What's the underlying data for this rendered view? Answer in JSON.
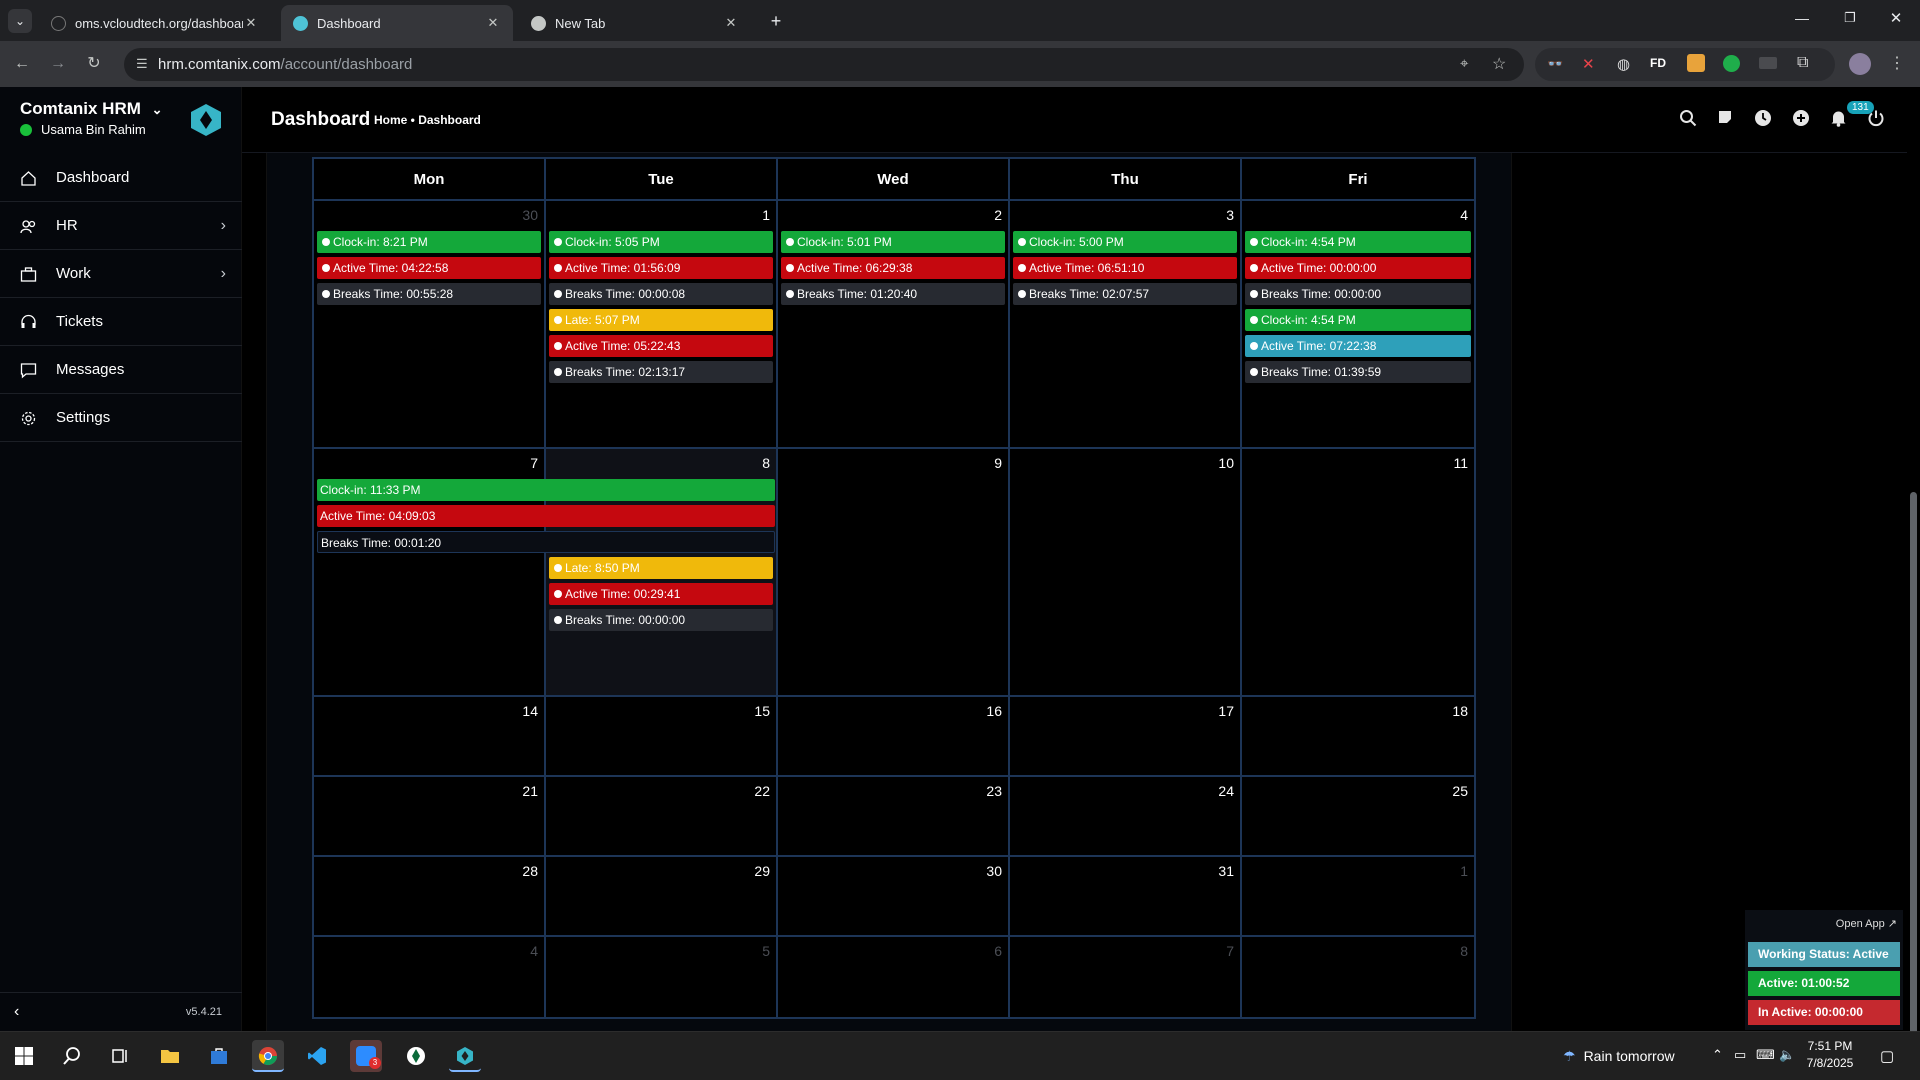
{
  "browser": {
    "tabs": [
      {
        "label": "oms.vcloudtech.org/dashboard",
        "active": false
      },
      {
        "label": "Dashboard",
        "active": true
      },
      {
        "label": "New Tab",
        "active": false
      }
    ],
    "url_host": "hrm.comtanix.com",
    "url_path": "/account/dashboard"
  },
  "app": {
    "brand": "Comtanix HRM",
    "user": "Usama Bin Rahim",
    "version": "v5.4.21",
    "nav": [
      {
        "label": "Dashboard",
        "icon": "home-icon",
        "chevron": false
      },
      {
        "label": "HR",
        "icon": "users-icon",
        "chevron": true
      },
      {
        "label": "Work",
        "icon": "briefcase-icon",
        "chevron": true
      },
      {
        "label": "Tickets",
        "icon": "headset-icon",
        "chevron": false
      },
      {
        "label": "Messages",
        "icon": "chat-icon",
        "chevron": false
      },
      {
        "label": "Settings",
        "icon": "gear-icon",
        "chevron": false
      }
    ],
    "page_title": "Dashboard",
    "breadcrumb": "Home • Dashboard",
    "notification_count": "131"
  },
  "calendar": {
    "day_headers": [
      "Mon",
      "Tue",
      "Wed",
      "Thu",
      "Fri"
    ],
    "weeks": [
      {
        "days": [
          {
            "num": "30",
            "other": true,
            "events": [
              {
                "text": "Clock-in: 8:21 PM",
                "color": "green"
              },
              {
                "text": "Active Time: 04:22:58",
                "color": "red"
              },
              {
                "text": "Breaks Time: 00:55:28",
                "color": "dark"
              }
            ]
          },
          {
            "num": "1",
            "other": false,
            "events": [
              {
                "text": "Clock-in: 5:05 PM",
                "color": "green"
              },
              {
                "text": "Active Time: 01:56:09",
                "color": "red"
              },
              {
                "text": "Breaks Time: 00:00:08",
                "color": "dark"
              },
              {
                "text": "Late: 5:07 PM",
                "color": "yellow"
              },
              {
                "text": "Active Time: 05:22:43",
                "color": "red"
              },
              {
                "text": "Breaks Time: 02:13:17",
                "color": "dark"
              }
            ]
          },
          {
            "num": "2",
            "other": false,
            "events": [
              {
                "text": "Clock-in: 5:01 PM",
                "color": "green"
              },
              {
                "text": "Active Time: 06:29:38",
                "color": "red"
              },
              {
                "text": "Breaks Time: 01:20:40",
                "color": "dark"
              }
            ]
          },
          {
            "num": "3",
            "other": false,
            "events": [
              {
                "text": "Clock-in: 5:00 PM",
                "color": "green"
              },
              {
                "text": "Active Time: 06:51:10",
                "color": "red"
              },
              {
                "text": "Breaks Time: 02:07:57",
                "color": "dark"
              }
            ]
          },
          {
            "num": "4",
            "other": false,
            "events": [
              {
                "text": "Clock-in: 4:54 PM",
                "color": "green"
              },
              {
                "text": "Active Time: 00:00:00",
                "color": "red"
              },
              {
                "text": "Breaks Time: 00:00:00",
                "color": "dark"
              },
              {
                "text": "Clock-in: 4:54 PM",
                "color": "green"
              },
              {
                "text": "Active Time: 07:22:38",
                "color": "teal"
              },
              {
                "text": "Breaks Time: 01:39:59",
                "color": "dark"
              }
            ]
          }
        ]
      },
      {
        "days": [
          {
            "num": "7",
            "other": false,
            "events": []
          },
          {
            "num": "8",
            "other": false,
            "today": true,
            "events": [
              {
                "text": "Late: 8:50 PM",
                "color": "yellow"
              },
              {
                "text": "Active Time: 00:29:41",
                "color": "red"
              },
              {
                "text": "Breaks Time: 00:00:00",
                "color": "dark"
              }
            ]
          },
          {
            "num": "9",
            "other": false,
            "events": []
          },
          {
            "num": "10",
            "other": false,
            "events": []
          },
          {
            "num": "11",
            "other": false,
            "events": []
          }
        ],
        "spanning": [
          {
            "text": "Clock-in: 11:33 PM",
            "color": "green"
          },
          {
            "text": "Active Time: 04:09:03",
            "color": "red"
          },
          {
            "text": "Breaks Time: 00:01:20",
            "color": "dark"
          }
        ]
      },
      {
        "days": [
          {
            "num": "14",
            "other": false,
            "events": []
          },
          {
            "num": "15",
            "other": false,
            "events": []
          },
          {
            "num": "16",
            "other": false,
            "events": []
          },
          {
            "num": "17",
            "other": false,
            "events": []
          },
          {
            "num": "18",
            "other": false,
            "events": []
          }
        ]
      },
      {
        "days": [
          {
            "num": "21",
            "other": false,
            "events": []
          },
          {
            "num": "22",
            "other": false,
            "events": []
          },
          {
            "num": "23",
            "other": false,
            "events": []
          },
          {
            "num": "24",
            "other": false,
            "events": []
          },
          {
            "num": "25",
            "other": false,
            "events": []
          }
        ]
      },
      {
        "days": [
          {
            "num": "28",
            "other": false,
            "events": []
          },
          {
            "num": "29",
            "other": false,
            "events": []
          },
          {
            "num": "30",
            "other": false,
            "events": []
          },
          {
            "num": "31",
            "other": false,
            "events": []
          },
          {
            "num": "1",
            "other": true,
            "events": []
          }
        ]
      },
      {
        "days": [
          {
            "num": "4",
            "other": true,
            "events": []
          },
          {
            "num": "5",
            "other": true,
            "events": []
          },
          {
            "num": "6",
            "other": true,
            "events": []
          },
          {
            "num": "7",
            "other": true,
            "events": []
          },
          {
            "num": "8",
            "other": true,
            "events": []
          }
        ]
      }
    ]
  },
  "widget": {
    "open_app": "Open App ↗",
    "working_status": "Working Status: Active",
    "active": "Active: 01:00:52",
    "inactive": "In Active: 00:00:00"
  },
  "taskbar": {
    "weather": "Rain tomorrow",
    "time": "7:51 PM",
    "date": "7/8/2025",
    "zoom_badge": "3"
  },
  "colors": {
    "green": "#14a83a",
    "red": "#c5080f",
    "yellow": "#f0b90b",
    "teal": "#2ea0ba",
    "grid": "#1d3557"
  }
}
